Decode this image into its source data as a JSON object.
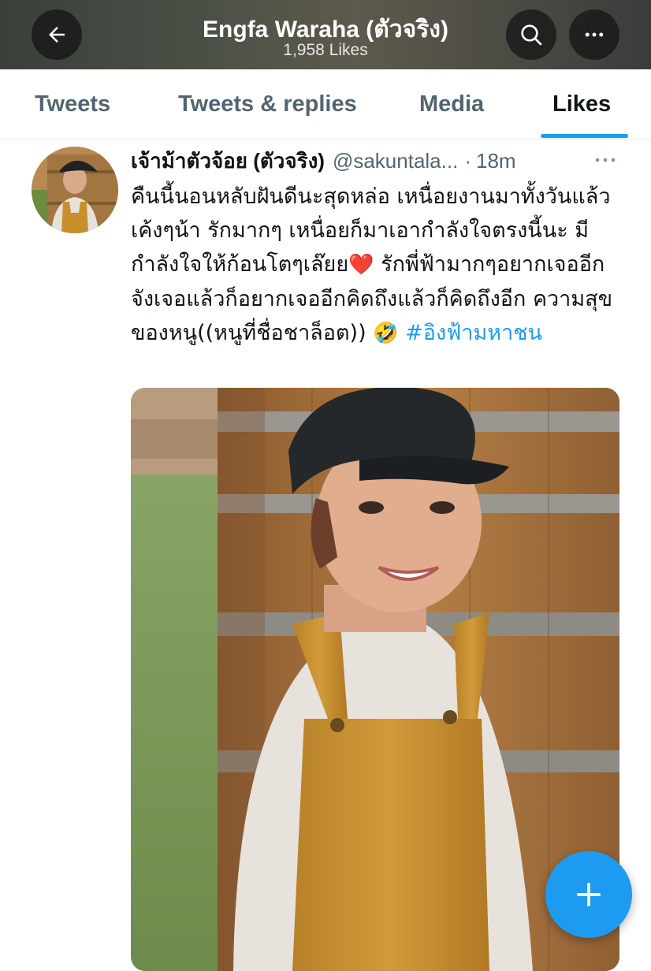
{
  "header": {
    "title": "Engfa Waraha (ตัวจริง)",
    "subtitle": "1,958 Likes",
    "back_icon": "arrow-left-icon",
    "search_icon": "search-icon",
    "more_icon": "more-horizontal-icon"
  },
  "tabs": [
    {
      "label": "Tweets",
      "active": false
    },
    {
      "label": "Tweets & replies",
      "active": false
    },
    {
      "label": "Media",
      "active": false
    },
    {
      "label": "Likes",
      "active": true
    }
  ],
  "tweet": {
    "author_name": "เจ้าม้าตัวจ้อย (ตัวจริง)",
    "handle": "@sakuntala...",
    "separator": "·",
    "time": "18m",
    "text_parts": {
      "p1": "คืนนี้นอนหลับฝันดีนะสุดหล่อ เหนื่อยงานมาทั้งวันแล้วเค้งๆน้า รักมากๆ เหนื่อยก็มาเอากำลังใจตรงนี้นะ มีกำลังใจให้ก้อนโตๆเล๊ยย",
      "emoji1": "❤️",
      "p2": " รักพี่ฟ้ามากๆอยากเจออีกจังเจอแล้วก็อยากเจออีกคิดถึงแล้วก็คิดถึงอีก ความสุขของหนู((หนูที่ชื่อชาล็อต)) ",
      "emoji2": "🤣",
      "hashtag": " #อิงฟ้ามหาชน"
    }
  },
  "compose_button_icon": "plus-icon",
  "colors": {
    "accent": "#1d9bf0",
    "text_primary": "#0f1419",
    "text_secondary": "#536471"
  }
}
